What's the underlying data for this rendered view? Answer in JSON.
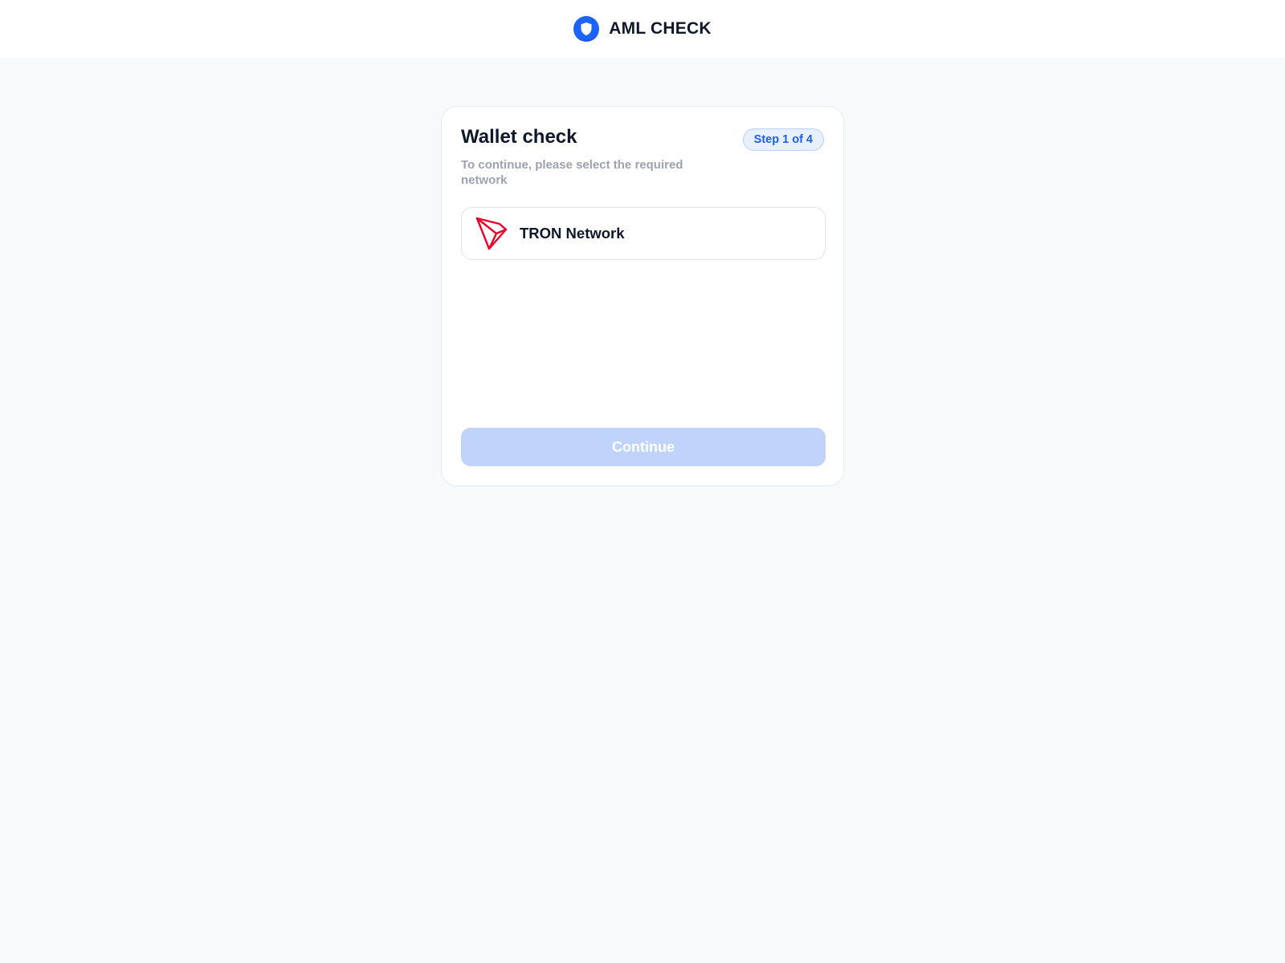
{
  "header": {
    "logo_icon": "shield-icon",
    "app_name": "AML CHECK"
  },
  "card": {
    "title": "Wallet check",
    "step_badge": "Step 1 of 4",
    "subtitle": "To continue, please select the required network",
    "networks": [
      {
        "label": "TRON Network",
        "icon": "tron-icon",
        "selected": false
      }
    ],
    "continue_label": "Continue",
    "continue_enabled": false
  },
  "colors": {
    "accent": "#1d63ff",
    "badge_bg": "#e8f0fe",
    "badge_text": "#1d5fe3",
    "button_disabled": "#bfd3fb",
    "tron_red": "#eb0029",
    "page_bg": "#f8f9fb"
  }
}
